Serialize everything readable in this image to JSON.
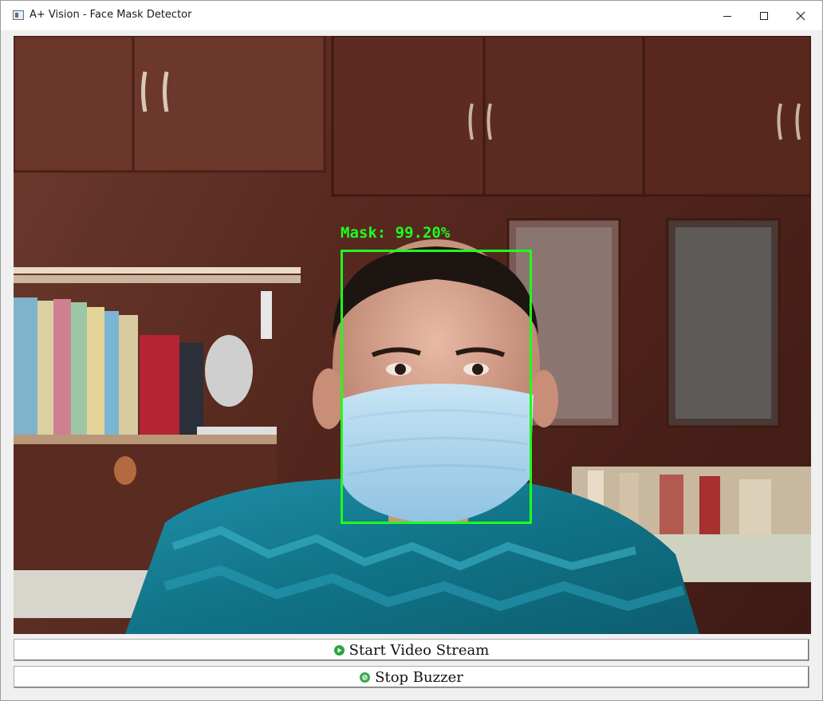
{
  "window": {
    "title": "A+ Vision - Face Mask Detector"
  },
  "video": {
    "detection_label": "Mask: 99.20%",
    "box_color": "#1eff1e"
  },
  "controls": {
    "start_label": "Start Video Stream",
    "stop_label": "Stop Buzzer",
    "start_icon": "play-icon",
    "stop_icon": "stop-icon"
  },
  "colors": {
    "accent_green": "#2aa53a"
  }
}
